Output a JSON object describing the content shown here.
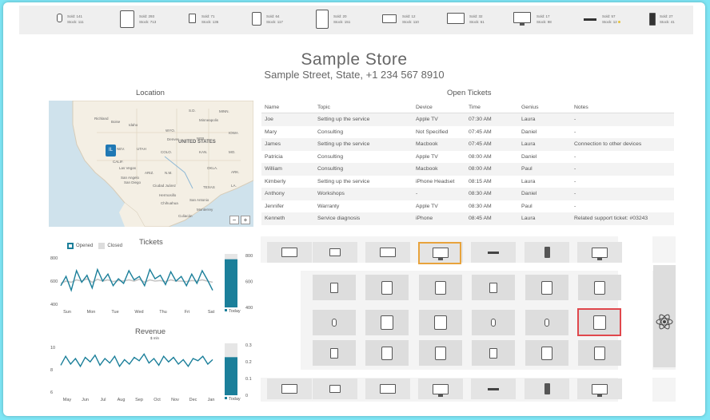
{
  "topbar": [
    {
      "icon": "watch-icon",
      "sold": "Sold: 141",
      "stock": "Stock: 111"
    },
    {
      "icon": "tablet-icon",
      "sold": "Sold: 293",
      "stock": "Stock: 713"
    },
    {
      "icon": "small-phone-icon",
      "sold": "Sold: 71",
      "stock": "Stock: 136"
    },
    {
      "icon": "phone-icon",
      "sold": "Sold: 64",
      "stock": "Stock: 117"
    },
    {
      "icon": "large-tablet-icon",
      "sold": "Sold: 20",
      "stock": "Stock: 151"
    },
    {
      "icon": "laptop-icon",
      "sold": "Sold: 12",
      "stock": "Stock: 110"
    },
    {
      "icon": "large-laptop-icon",
      "sold": "Sold: 32",
      "stock": "Stock: 61"
    },
    {
      "icon": "monitor-icon",
      "sold": "Sold: 17",
      "stock": "Stock: 98"
    },
    {
      "icon": "apple-tv-icon",
      "sold": "Sold: 57",
      "stock": "Stock: 12"
    },
    {
      "icon": "ipod-icon",
      "sold": "Sold: 27",
      "stock": "Stock: 41"
    }
  ],
  "store": {
    "name": "Sample Store",
    "address": "Sample Street, State, +1 234 567 8910"
  },
  "location": {
    "title": "Location",
    "pin_label": "IL",
    "map_labels": [
      "Richland",
      "Boise",
      "Idaho",
      "S.D.",
      "Minneapolis",
      "MINN.",
      "WYO.",
      "IOWA",
      "NEB.",
      "UTAH",
      "COLO.",
      "UNITED STATES",
      "KAN.",
      "MO.",
      "Denver",
      "NEV.",
      "Las Vegas",
      "ARIZ.",
      "N.M.",
      "OKLA.",
      "ARK.",
      "San Angelo",
      "San Diego",
      "Ciudad Juárez",
      "TEXAS",
      "LA.",
      "Hermosillo",
      "Chihuahua",
      "San Antonio",
      "Monterrey",
      "Culiacán",
      "CALIF."
    ],
    "zoom_out": "−",
    "zoom_in": "+"
  },
  "tickets_table": {
    "title": "Open Tickets",
    "columns": [
      "Name",
      "Topic",
      "Device",
      "Time",
      "Genius",
      "Notes"
    ],
    "rows": [
      [
        "Joe",
        "Setting up the service",
        "Apple TV",
        "07:30 AM",
        "Laura",
        "-"
      ],
      [
        "Mary",
        "Consulting",
        "Not Specified",
        "07:45 AM",
        "Daniel",
        "-"
      ],
      [
        "James",
        "Setting up the service",
        "Macbook",
        "07:45 AM",
        "Laura",
        "Connection to other devices"
      ],
      [
        "Patricia",
        "Consulting",
        "Apple TV",
        "08:00 AM",
        "Daniel",
        "-"
      ],
      [
        "William",
        "Consulting",
        "Macbook",
        "08:00 AM",
        "Paul",
        "-"
      ],
      [
        "Kimberly",
        "Setting up the service",
        "iPhone Headset",
        "08:15 AM",
        "Laura",
        "-"
      ],
      [
        "Anthony",
        "Workshops",
        "-",
        "08:30 AM",
        "Daniel",
        "-"
      ],
      [
        "Jennifer",
        "Warranty",
        "Apple TV",
        "08:30 AM",
        "Paul",
        "-"
      ],
      [
        "Kenneth",
        "Service diagnosis",
        "iPhone",
        "08:45 AM",
        "Laura",
        "Related support ticket: #03243"
      ]
    ]
  },
  "colors": {
    "teal": "#1b7f9a",
    "gray": "#c4c4c4",
    "orange": "#e8a33c",
    "red": "#e0474c"
  },
  "chart_data": [
    {
      "type": "line",
      "title": "Tickets",
      "legend": [
        "Opened",
        "Closed"
      ],
      "categories": [
        "Sun",
        "Mon",
        "Tue",
        "Wed",
        "Thu",
        "Fri",
        "Sat"
      ],
      "ylim": [
        400,
        800
      ],
      "yticks": [
        "800",
        "600",
        "400"
      ],
      "series": [
        {
          "name": "Opened",
          "values": [
            560,
            640,
            520,
            690,
            590,
            650,
            540,
            700,
            600,
            660,
            560,
            620,
            580,
            690,
            610,
            640,
            560,
            700,
            620,
            650,
            570,
            680,
            600,
            640,
            560,
            660,
            580,
            690,
            610,
            520
          ]
        },
        {
          "name": "Closed",
          "values": [
            580,
            600,
            590,
            610,
            600,
            620,
            590,
            615,
            600,
            610,
            595,
            605,
            600,
            610,
            600,
            615,
            590,
            610,
            600,
            605,
            595,
            610,
            600,
            600,
            595,
            605,
            600,
            610,
            600,
            590
          ]
        }
      ],
      "bar": {
        "label": "Today",
        "value": 720,
        "max": 800,
        "ticks": [
          "800",
          "600",
          "400"
        ]
      }
    },
    {
      "type": "line",
      "title": "Revenue",
      "subtitle": "$ mln",
      "categories": [
        "May",
        "Jun",
        "Jul",
        "Aug",
        "Sep",
        "Oct",
        "Nov",
        "Dec",
        "Jan"
      ],
      "ylim": [
        6,
        10
      ],
      "yticks": [
        "10",
        "8",
        "6"
      ],
      "series": [
        {
          "name": "Revenue",
          "values": [
            8.4,
            9.2,
            8.5,
            9.0,
            8.3,
            9.1,
            8.7,
            9.3,
            8.4,
            9.0,
            8.6,
            9.2,
            8.3,
            8.9,
            8.5,
            9.1,
            8.8,
            9.4,
            8.6,
            9.0,
            8.4,
            9.2,
            8.7,
            9.1,
            8.5,
            8.9,
            8.3,
            9.0,
            8.8,
            9.2,
            8.5,
            8.9
          ]
        }
      ],
      "bar": {
        "label": "Today",
        "value": 0.22,
        "max": 0.3,
        "ticks": [
          "0.3",
          "0.2",
          "0.1",
          "0"
        ]
      }
    }
  ]
}
